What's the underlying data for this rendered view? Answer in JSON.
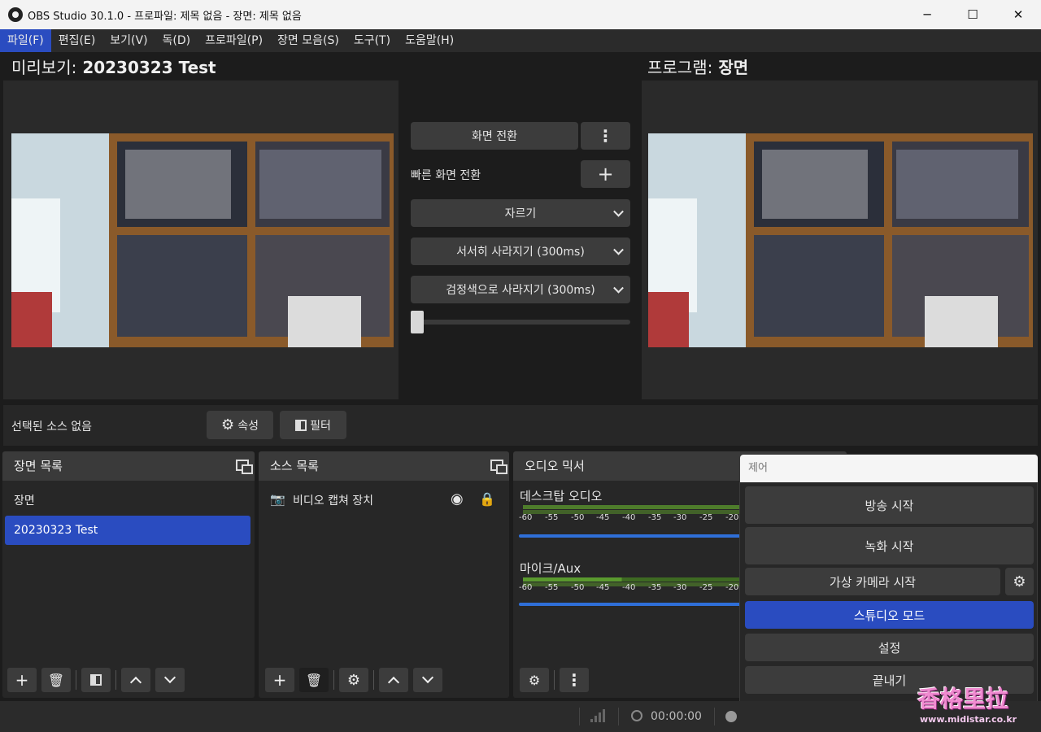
{
  "window": {
    "title": "OBS Studio 30.1.0 - 프로파일: 제목 없음 - 장면: 제목 없음",
    "minimize": "─",
    "maximize": "☐",
    "close": "✕"
  },
  "menu": [
    {
      "label": "파일(F)",
      "active": true
    },
    {
      "label": "편집(E)"
    },
    {
      "label": "보기(V)"
    },
    {
      "label": "독(D)"
    },
    {
      "label": "프로파일(P)"
    },
    {
      "label": "장면 모음(S)"
    },
    {
      "label": "도구(T)"
    },
    {
      "label": "도움말(H)"
    }
  ],
  "preview": {
    "label": "미리보기:",
    "scene": "20230323 Test"
  },
  "program": {
    "label": "프로그램:",
    "scene": "장면"
  },
  "transitions": {
    "transition_button": "화면 전환",
    "more": "⋮",
    "quick_label": "빠른 화면 전환",
    "add": "+",
    "quick_items": [
      "자르기",
      "서서히 사라지기 (300ms)",
      "검정색으로 사라지기 (300ms)"
    ],
    "tbar_value": 0
  },
  "source_bar": {
    "status": "선택된 소스 없음",
    "properties": "속성",
    "filters": "필터"
  },
  "scenes": {
    "title": "장면 목록",
    "items": [
      "장면",
      "20230323 Test"
    ],
    "selected": 1
  },
  "sources": {
    "title": "소스 목록",
    "items": [
      {
        "name": "비디오 캡쳐 장치"
      }
    ]
  },
  "mixer": {
    "title": "오디오 믹서",
    "ticks": [
      "-60",
      "-55",
      "-50",
      "-45",
      "-40",
      "-35",
      "-30",
      "-25",
      "-20"
    ],
    "channels": [
      {
        "name": "데스크탑 오디오"
      },
      {
        "name": "마이크/Aux"
      }
    ]
  },
  "controls": {
    "title": "제어",
    "stream": "방송 시작",
    "record": "녹화 시작",
    "virtual_cam": "가상 카메라 시작",
    "studio_mode": "스튜디오 모드",
    "settings": "설정",
    "exit": "끝내기"
  },
  "status": {
    "time": "00:00:00"
  },
  "watermark": {
    "brand": "香格里拉",
    "site": "www.midistar.co.kr"
  },
  "colors": {
    "accent": "#2a4cc0",
    "volume": "#2f6fd8",
    "meter": "#4e7c2b"
  }
}
